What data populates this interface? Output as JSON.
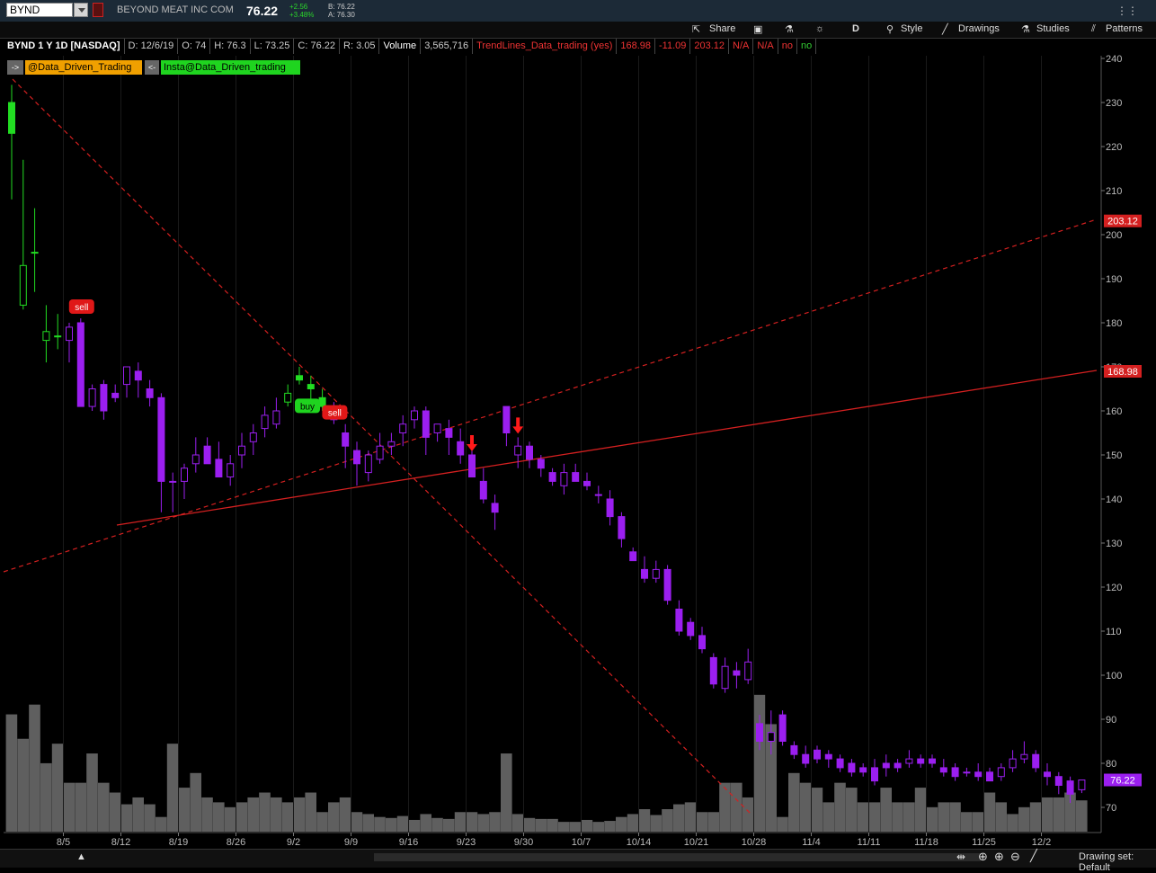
{
  "header": {
    "symbol": "BYND",
    "company": "BEYOND MEAT INC COM",
    "last": "76.22",
    "change": "+2.56",
    "change_pct": "+3.48%",
    "bid": "B: 76.22",
    "ask": "A: 76.30"
  },
  "toolbar": {
    "share": "Share",
    "period": "D",
    "style": "Style",
    "drawings": "Drawings",
    "studies": "Studies",
    "patterns": "Patterns"
  },
  "info": {
    "title": "BYND 1 Y 1D [NASDAQ]",
    "date": "D: 12/6/19",
    "open": "O: 74",
    "high": "H: 76.3",
    "low": "L: 73.25",
    "close": "C: 76.22",
    "range": "R: 3.05",
    "volume_label": "Volume",
    "volume": "3,565,716",
    "study": "TrendLines_Data_trading (yes)",
    "v1": "168.98",
    "v2": "-11.09",
    "v3": "203.12",
    "v4": "N/A",
    "v5": "N/A",
    "v6": "no",
    "v7": "no"
  },
  "chips": {
    "arrow1": "->",
    "handle1": "@Data_Driven_Trading",
    "arrow2": "<-",
    "handle2": "Insta@Data_Driven_trading"
  },
  "footer": {
    "drawing_set": "Drawing set: Default"
  },
  "colors": {
    "up": "#22dd22",
    "down": "#9b1ff0",
    "trend": "#d42020",
    "volume": "#5f5f5f"
  },
  "chart_data": {
    "type": "candlestick",
    "ylim": [
      65,
      242
    ],
    "yticks": [
      70,
      80,
      90,
      100,
      110,
      120,
      130,
      140,
      150,
      160,
      170,
      180,
      190,
      200,
      210,
      220,
      230,
      240
    ],
    "xticks": [
      "8/5",
      "8/12",
      "8/19",
      "8/26",
      "9/2",
      "9/9",
      "9/16",
      "9/23",
      "9/30",
      "10/7",
      "10/14",
      "10/21",
      "10/28",
      "11/4",
      "11/11",
      "11/18",
      "11/25",
      "12/2"
    ],
    "xtick_index": [
      5,
      10,
      15,
      20,
      25,
      30,
      35,
      40,
      45,
      50,
      55,
      60,
      65,
      70,
      75,
      80,
      85,
      90
    ],
    "price_labels": {
      "trend_solid": "168.98",
      "trend_dashed": "203.12",
      "last": "76.22"
    },
    "signal_labels": {
      "sell": "sell",
      "buy": "buy"
    },
    "signals": [
      {
        "type": "sell",
        "index": 6,
        "price": 180
      },
      {
        "type": "buy",
        "index": 25,
        "price": 164
      },
      {
        "type": "sell",
        "index": 28,
        "price": 156
      }
    ],
    "arrows": [
      {
        "index": 40,
        "price": 150
      },
      {
        "index": 44,
        "price": 154
      }
    ],
    "ohlc": [
      [
        230,
        234,
        208,
        223
      ],
      [
        184,
        217,
        183,
        193
      ],
      [
        196,
        206,
        187,
        196
      ],
      [
        176,
        184,
        171,
        178
      ],
      [
        177,
        182,
        174,
        177
      ],
      [
        176,
        180,
        171,
        179
      ],
      [
        180,
        181,
        161,
        161
      ],
      [
        161,
        166,
        160,
        165
      ],
      [
        166,
        167,
        158,
        160
      ],
      [
        164,
        166,
        162,
        163
      ],
      [
        166,
        170,
        163,
        170
      ],
      [
        169,
        171,
        163,
        167
      ],
      [
        165,
        167,
        161,
        163
      ],
      [
        163,
        164,
        137,
        144
      ],
      [
        144,
        146,
        137,
        144
      ],
      [
        144,
        148,
        140,
        147
      ],
      [
        148,
        154,
        146,
        150
      ],
      [
        152,
        154,
        148,
        148
      ],
      [
        149,
        153,
        145,
        145
      ],
      [
        145,
        150,
        143,
        148
      ],
      [
        150,
        155,
        147,
        152
      ],
      [
        153,
        157,
        150,
        155
      ],
      [
        156,
        161,
        154,
        159
      ],
      [
        157,
        163,
        156,
        160
      ],
      [
        162,
        166,
        161,
        164
      ],
      [
        168,
        170,
        166,
        167
      ],
      [
        166,
        168,
        162,
        165
      ],
      [
        163,
        165,
        160,
        161
      ],
      [
        160,
        162,
        157,
        158
      ],
      [
        155,
        157,
        147,
        152
      ],
      [
        151,
        153,
        143,
        148
      ],
      [
        146,
        151,
        144,
        150
      ],
      [
        149,
        155,
        148,
        152
      ],
      [
        152,
        155,
        150,
        153
      ],
      [
        155,
        159,
        152,
        157
      ],
      [
        158,
        161,
        156,
        160
      ],
      [
        160,
        161,
        150,
        154
      ],
      [
        155,
        157,
        153,
        157
      ],
      [
        156,
        158,
        150,
        154
      ],
      [
        153,
        156,
        148,
        150
      ],
      [
        150,
        152,
        145,
        145
      ],
      [
        144,
        147,
        139,
        140
      ],
      [
        139,
        141,
        133,
        137
      ],
      [
        161,
        161,
        152,
        155
      ],
      [
        150,
        154,
        147,
        152
      ],
      [
        152,
        153,
        147,
        149
      ],
      [
        149,
        150,
        145,
        147
      ],
      [
        146,
        147,
        143,
        144
      ],
      [
        143,
        148,
        141,
        146
      ],
      [
        146,
        148,
        144,
        144
      ],
      [
        144,
        146,
        142,
        143
      ],
      [
        141,
        143,
        139,
        141
      ],
      [
        140,
        142,
        134,
        136
      ],
      [
        136,
        137,
        129,
        131
      ],
      [
        128,
        129,
        126,
        126
      ],
      [
        124,
        127,
        121,
        122
      ],
      [
        122,
        126,
        121,
        124
      ],
      [
        124,
        125,
        116,
        117
      ],
      [
        115,
        117,
        109,
        110
      ],
      [
        112,
        113,
        108,
        109
      ],
      [
        109,
        111,
        105,
        106
      ],
      [
        104,
        105,
        97,
        98
      ],
      [
        97,
        104,
        96,
        102
      ],
      [
        101,
        103,
        97,
        100
      ],
      [
        99,
        106,
        98,
        103
      ],
      [
        89,
        91,
        83,
        85
      ],
      [
        85,
        92,
        82,
        87
      ],
      [
        91,
        92,
        84,
        85
      ],
      [
        84,
        85,
        81,
        82
      ],
      [
        82,
        84,
        79,
        80
      ],
      [
        83,
        84,
        80,
        81
      ],
      [
        82,
        83,
        79,
        81
      ],
      [
        81,
        82,
        78,
        79
      ],
      [
        80,
        81,
        77,
        78
      ],
      [
        79,
        80,
        77,
        78
      ],
      [
        79,
        81,
        75,
        76
      ],
      [
        80,
        82,
        77,
        79
      ],
      [
        80,
        81,
        78,
        79
      ],
      [
        80,
        83,
        79,
        81
      ],
      [
        81,
        82,
        79,
        80
      ],
      [
        81,
        82,
        79,
        80
      ],
      [
        79,
        81,
        77,
        78
      ],
      [
        79,
        80,
        76,
        77
      ],
      [
        78,
        79,
        77,
        78
      ],
      [
        78,
        80,
        76,
        77
      ],
      [
        78,
        79,
        76,
        76
      ],
      [
        77,
        80,
        76,
        79
      ],
      [
        79,
        83,
        78,
        81
      ],
      [
        81,
        85,
        80,
        82
      ],
      [
        82,
        83,
        78,
        79
      ],
      [
        78,
        80,
        75,
        77
      ],
      [
        77,
        78,
        73,
        75
      ],
      [
        76,
        77,
        71,
        73
      ],
      [
        74,
        76.3,
        73.25,
        76.22
      ]
    ],
    "volume_ylim": [
      0,
      23
    ],
    "volume": [
      12,
      9.5,
      13,
      7,
      9,
      5,
      5,
      8,
      5,
      4,
      2.8,
      3.5,
      2.8,
      1.5,
      9,
      4.5,
      6,
      3.5,
      3,
      2.5,
      3,
      3.5,
      4,
      3.5,
      3,
      3.5,
      4,
      2,
      3,
      3.5,
      2,
      1.8,
      1.5,
      1.4,
      1.6,
      1.2,
      1.8,
      1.4,
      1.3,
      2,
      2,
      1.8,
      2,
      8,
      1.8,
      1.4,
      1.3,
      1.3,
      1,
      1,
      1.2,
      1,
      1.1,
      1.5,
      1.8,
      2.3,
      1.7,
      2.3,
      2.8,
      3,
      2,
      2,
      5,
      5,
      3.5,
      14,
      11,
      1.5,
      6,
      5,
      4.5,
      3,
      5,
      4.5,
      3,
      3,
      4.5,
      3,
      3,
      4.5,
      2.5,
      3,
      3,
      2,
      2,
      4,
      3,
      1.8,
      2.5,
      3,
      3.5,
      3.5,
      4,
      3.2
    ]
  }
}
